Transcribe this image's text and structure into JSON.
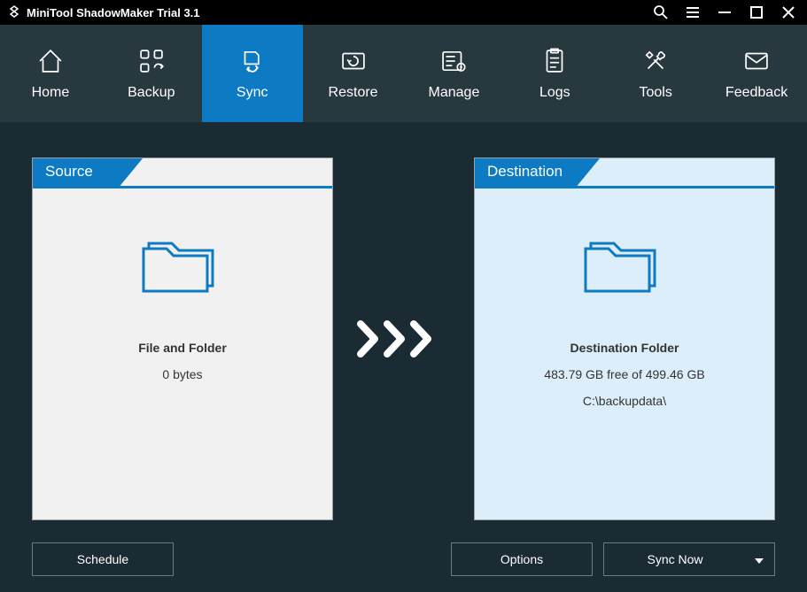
{
  "titlebar": {
    "title": "MiniTool ShadowMaker Trial 3.1"
  },
  "nav": {
    "items": [
      {
        "label": "Home"
      },
      {
        "label": "Backup"
      },
      {
        "label": "Sync"
      },
      {
        "label": "Restore"
      },
      {
        "label": "Manage"
      },
      {
        "label": "Logs"
      },
      {
        "label": "Tools"
      },
      {
        "label": "Feedback"
      }
    ],
    "active_index": 2
  },
  "source": {
    "header": "Source",
    "line1": "File and Folder",
    "line2": "0 bytes"
  },
  "destination": {
    "header": "Destination",
    "line1": "Destination Folder",
    "line2": "483.79 GB free of 499.46 GB",
    "line3": "C:\\backupdata\\"
  },
  "buttons": {
    "schedule": "Schedule",
    "options": "Options",
    "sync_now": "Sync Now"
  },
  "colors": {
    "accent": "#0d7bc4",
    "bg": "#1a2b34",
    "navbg": "#28383f"
  }
}
